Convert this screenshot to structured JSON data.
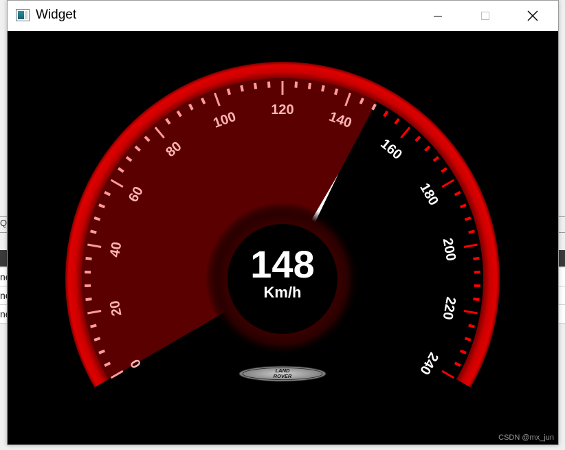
{
  "window": {
    "title": "Widget",
    "icon": "app-window-icon",
    "controls": [
      "minimize-icon",
      "maximize-icon",
      "close-icon"
    ]
  },
  "background_app": {
    "fragment": "Q",
    "rows": [
      "ne",
      "ne",
      "ne"
    ]
  },
  "speedometer": {
    "speed_value": "148",
    "unit": "Km/h",
    "min": 0,
    "max": 240,
    "major_step": 20,
    "tick_labels": [
      "0",
      "20",
      "40",
      "60",
      "80",
      "100",
      "120",
      "140",
      "160",
      "180",
      "200",
      "220",
      "240"
    ],
    "logo_text_top": "LAND",
    "logo_text_bottom": "ROVER",
    "colors": {
      "background": "#000000",
      "rim": "#cc0000",
      "filled_sector": "#5a0000",
      "tick_active": "#ff9a9a",
      "tick_inactive": "#ff0000",
      "label_active": "#ffb3b3",
      "label_inactive": "#ffffff",
      "needle": "#ffffff",
      "readout": "#ffffff"
    }
  },
  "watermark": "CSDN @mx_jun"
}
